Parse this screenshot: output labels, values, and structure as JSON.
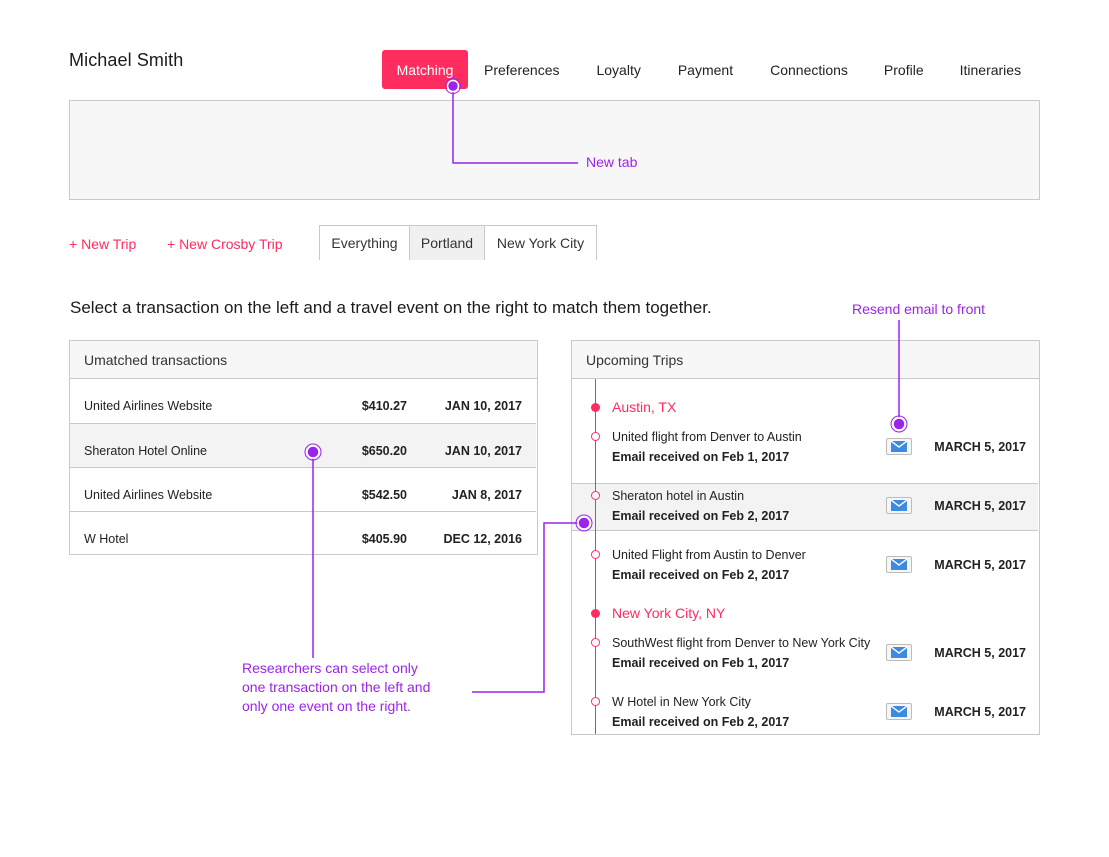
{
  "user": {
    "name": "Michael Smith"
  },
  "nav": {
    "tabs": [
      {
        "label": "Matching",
        "active": true
      },
      {
        "label": "Preferences"
      },
      {
        "label": "Loyalty"
      },
      {
        "label": "Payment"
      },
      {
        "label": "Connections"
      },
      {
        "label": "Profile"
      },
      {
        "label": "Itineraries"
      }
    ]
  },
  "actions": {
    "new_trip": "+ New Trip",
    "new_crosby_trip": "+ New Crosby Trip"
  },
  "trip_tabs": [
    {
      "label": "Everything",
      "selected": true
    },
    {
      "label": "Portland"
    },
    {
      "label": "New York City"
    }
  ],
  "instructions": "Select a transaction on the left and a travel event on the right to match them together.",
  "transactions": {
    "title": "Umatched transactions",
    "rows": [
      {
        "name": "United Airlines Website",
        "amount": "$410.27",
        "date": "JAN 10, 2017"
      },
      {
        "name": "Sheraton Hotel Online",
        "amount": "$650.20",
        "date": "JAN 10, 2017",
        "selected": true
      },
      {
        "name": "United Airlines Website",
        "amount": "$542.50",
        "date": "JAN 8, 2017"
      },
      {
        "name": "W Hotel",
        "amount": "$405.90",
        "date": "DEC 12, 2016"
      }
    ]
  },
  "trips": {
    "title": "Upcoming Trips",
    "cities": [
      {
        "name": "Austin, TX",
        "events": [
          {
            "title": "United flight from Denver to Austin",
            "email": "Email received on Feb 1, 2017",
            "date": "MARCH 5, 2017"
          },
          {
            "title": "Sheraton hotel in Austin",
            "email": "Email received on Feb 2, 2017",
            "date": "MARCH 5, 2017",
            "selected": true
          },
          {
            "title": "United Flight from Austin to Denver",
            "email": "Email received on Feb 2, 2017",
            "date": "MARCH 5, 2017"
          }
        ]
      },
      {
        "name": "New York City, NY",
        "events": [
          {
            "title": "SouthWest flight from Denver to New York City",
            "email": "Email received on Feb 1, 2017",
            "date": "MARCH 5, 2017"
          },
          {
            "title": "W Hotel in New York City",
            "email": "Email received on Feb 2, 2017",
            "date": "MARCH 5, 2017"
          }
        ]
      }
    ]
  },
  "annotations": {
    "new_tab": "New tab",
    "resend_email": "Resend email to front",
    "researchers_line1": "Researchers can select only",
    "researchers_line2": "one transaction on the left and",
    "researchers_line3": "only one event on the right."
  },
  "colors": {
    "accent": "#ff2d5f",
    "annotation": "#9b24ea",
    "mail_icon": "#3d8be0",
    "panel_bg": "#f7f7f7",
    "border": "#c9c9c9"
  },
  "icons": {
    "mail": "mail-icon",
    "city_marker": "filled-dot-icon",
    "event_marker": "ring-dot-icon"
  }
}
